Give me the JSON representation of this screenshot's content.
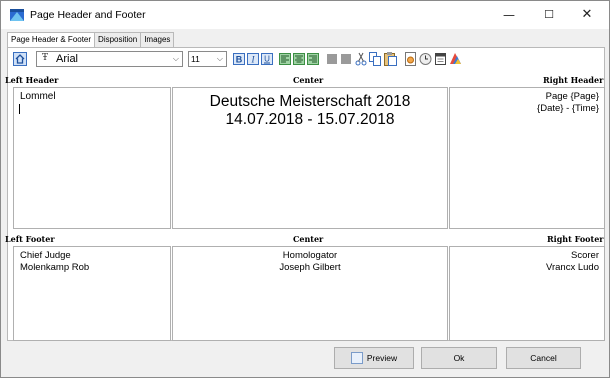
{
  "window": {
    "title": "Page Header and Footer",
    "controls": {
      "minimize": "—",
      "maximize": "☐",
      "close": "✕"
    }
  },
  "tabs": [
    {
      "label": "Page Header & Footer",
      "active": true
    },
    {
      "label": "Disposition",
      "active": false
    },
    {
      "label": "Images",
      "active": false
    }
  ],
  "toolbar": {
    "font_name": "Arial",
    "font_glyph": "Ŧ",
    "font_size": "11",
    "icons": [
      "home-icon",
      "bold-icon",
      "italic-icon",
      "underline-icon",
      "align-left-icon",
      "align-center-icon",
      "align-right-icon",
      "square-icon",
      "square-icon",
      "cut-icon",
      "copy-icon",
      "paste-icon",
      "page-icon",
      "clock-icon",
      "calendar-icon",
      "color-icon"
    ]
  },
  "header": {
    "left_label": "Left Header",
    "center_label": "Center",
    "right_label": "Right Header",
    "left_lines": [
      "Lommel"
    ],
    "center_lines": [
      "Deutsche Meisterschaft 2018",
      "14.07.2018 - 15.07.2018"
    ],
    "right_lines": [
      "Page {Page}",
      "{Date} - {Time}"
    ]
  },
  "footer": {
    "left_label": "Left Footer",
    "center_label": "Center",
    "right_label": "Right Footer",
    "left_lines": [
      "Chief Judge",
      "Molenkamp Rob"
    ],
    "center_lines": [
      "Homologator",
      "Joseph Gilbert"
    ],
    "right_lines": [
      "Scorer",
      "Vrancx Ludo"
    ]
  },
  "buttons": {
    "preview": "Preview",
    "ok": "Ok",
    "cancel": "Cancel"
  },
  "colors": {
    "accent": "#3a7bd5",
    "border": "#b0b0b0"
  }
}
